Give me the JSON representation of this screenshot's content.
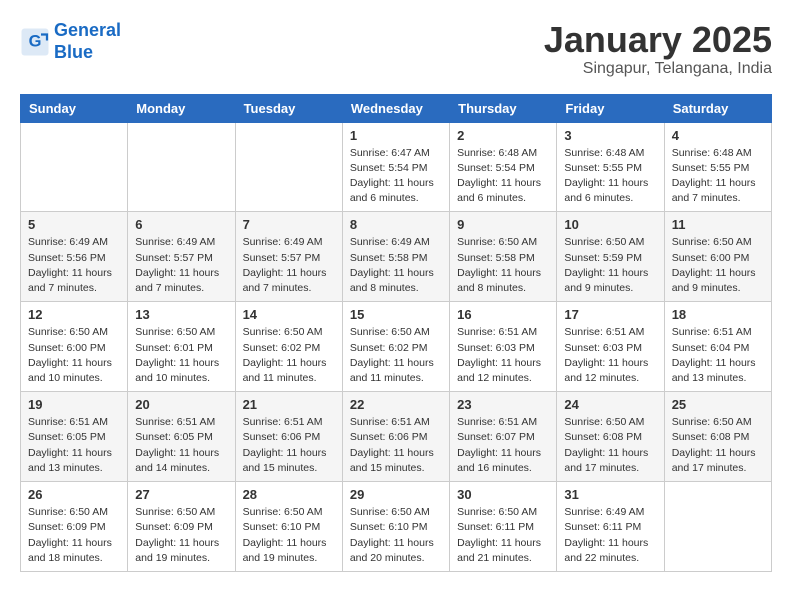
{
  "header": {
    "logo_line1": "General",
    "logo_line2": "Blue",
    "title": "January 2025",
    "subtitle": "Singapur, Telangana, India"
  },
  "weekdays": [
    "Sunday",
    "Monday",
    "Tuesday",
    "Wednesday",
    "Thursday",
    "Friday",
    "Saturday"
  ],
  "weeks": [
    [
      {
        "day": "",
        "info": ""
      },
      {
        "day": "",
        "info": ""
      },
      {
        "day": "",
        "info": ""
      },
      {
        "day": "1",
        "info": "Sunrise: 6:47 AM\nSunset: 5:54 PM\nDaylight: 11 hours and 6 minutes."
      },
      {
        "day": "2",
        "info": "Sunrise: 6:48 AM\nSunset: 5:54 PM\nDaylight: 11 hours and 6 minutes."
      },
      {
        "day": "3",
        "info": "Sunrise: 6:48 AM\nSunset: 5:55 PM\nDaylight: 11 hours and 6 minutes."
      },
      {
        "day": "4",
        "info": "Sunrise: 6:48 AM\nSunset: 5:55 PM\nDaylight: 11 hours and 7 minutes."
      }
    ],
    [
      {
        "day": "5",
        "info": "Sunrise: 6:49 AM\nSunset: 5:56 PM\nDaylight: 11 hours and 7 minutes."
      },
      {
        "day": "6",
        "info": "Sunrise: 6:49 AM\nSunset: 5:57 PM\nDaylight: 11 hours and 7 minutes."
      },
      {
        "day": "7",
        "info": "Sunrise: 6:49 AM\nSunset: 5:57 PM\nDaylight: 11 hours and 7 minutes."
      },
      {
        "day": "8",
        "info": "Sunrise: 6:49 AM\nSunset: 5:58 PM\nDaylight: 11 hours and 8 minutes."
      },
      {
        "day": "9",
        "info": "Sunrise: 6:50 AM\nSunset: 5:58 PM\nDaylight: 11 hours and 8 minutes."
      },
      {
        "day": "10",
        "info": "Sunrise: 6:50 AM\nSunset: 5:59 PM\nDaylight: 11 hours and 9 minutes."
      },
      {
        "day": "11",
        "info": "Sunrise: 6:50 AM\nSunset: 6:00 PM\nDaylight: 11 hours and 9 minutes."
      }
    ],
    [
      {
        "day": "12",
        "info": "Sunrise: 6:50 AM\nSunset: 6:00 PM\nDaylight: 11 hours and 10 minutes."
      },
      {
        "day": "13",
        "info": "Sunrise: 6:50 AM\nSunset: 6:01 PM\nDaylight: 11 hours and 10 minutes."
      },
      {
        "day": "14",
        "info": "Sunrise: 6:50 AM\nSunset: 6:02 PM\nDaylight: 11 hours and 11 minutes."
      },
      {
        "day": "15",
        "info": "Sunrise: 6:50 AM\nSunset: 6:02 PM\nDaylight: 11 hours and 11 minutes."
      },
      {
        "day": "16",
        "info": "Sunrise: 6:51 AM\nSunset: 6:03 PM\nDaylight: 11 hours and 12 minutes."
      },
      {
        "day": "17",
        "info": "Sunrise: 6:51 AM\nSunset: 6:03 PM\nDaylight: 11 hours and 12 minutes."
      },
      {
        "day": "18",
        "info": "Sunrise: 6:51 AM\nSunset: 6:04 PM\nDaylight: 11 hours and 13 minutes."
      }
    ],
    [
      {
        "day": "19",
        "info": "Sunrise: 6:51 AM\nSunset: 6:05 PM\nDaylight: 11 hours and 13 minutes."
      },
      {
        "day": "20",
        "info": "Sunrise: 6:51 AM\nSunset: 6:05 PM\nDaylight: 11 hours and 14 minutes."
      },
      {
        "day": "21",
        "info": "Sunrise: 6:51 AM\nSunset: 6:06 PM\nDaylight: 11 hours and 15 minutes."
      },
      {
        "day": "22",
        "info": "Sunrise: 6:51 AM\nSunset: 6:06 PM\nDaylight: 11 hours and 15 minutes."
      },
      {
        "day": "23",
        "info": "Sunrise: 6:51 AM\nSunset: 6:07 PM\nDaylight: 11 hours and 16 minutes."
      },
      {
        "day": "24",
        "info": "Sunrise: 6:50 AM\nSunset: 6:08 PM\nDaylight: 11 hours and 17 minutes."
      },
      {
        "day": "25",
        "info": "Sunrise: 6:50 AM\nSunset: 6:08 PM\nDaylight: 11 hours and 17 minutes."
      }
    ],
    [
      {
        "day": "26",
        "info": "Sunrise: 6:50 AM\nSunset: 6:09 PM\nDaylight: 11 hours and 18 minutes."
      },
      {
        "day": "27",
        "info": "Sunrise: 6:50 AM\nSunset: 6:09 PM\nDaylight: 11 hours and 19 minutes."
      },
      {
        "day": "28",
        "info": "Sunrise: 6:50 AM\nSunset: 6:10 PM\nDaylight: 11 hours and 19 minutes."
      },
      {
        "day": "29",
        "info": "Sunrise: 6:50 AM\nSunset: 6:10 PM\nDaylight: 11 hours and 20 minutes."
      },
      {
        "day": "30",
        "info": "Sunrise: 6:50 AM\nSunset: 6:11 PM\nDaylight: 11 hours and 21 minutes."
      },
      {
        "day": "31",
        "info": "Sunrise: 6:49 AM\nSunset: 6:11 PM\nDaylight: 11 hours and 22 minutes."
      },
      {
        "day": "",
        "info": ""
      }
    ]
  ]
}
